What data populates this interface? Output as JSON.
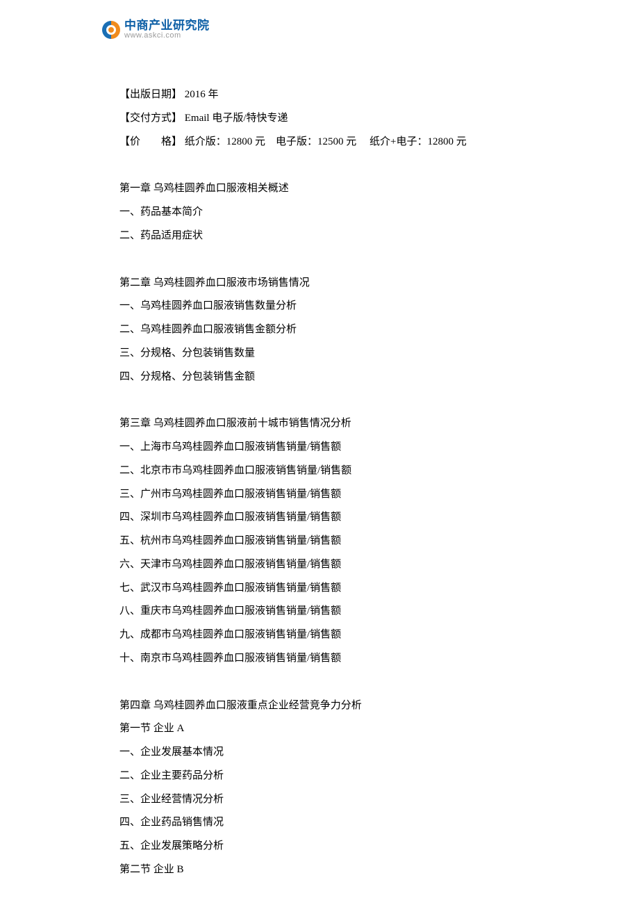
{
  "logo": {
    "name_cn": "中商产业研究院",
    "name_en": "www.askci.com"
  },
  "meta": {
    "pub_date_label": "【出版日期】",
    "pub_date_value": " 2016 年",
    "delivery_label": "【交付方式】",
    "delivery_value": " Email 电子版/特快专递",
    "price_label": "【价　　格】",
    "price_value": " 纸介版：12800 元　电子版：12500 元 　纸介+电子：12800 元"
  },
  "chapters": [
    {
      "title": "第一章 乌鸡桂圆养血口服液相关概述",
      "items": [
        "一、药品基本简介",
        "二、药品适用症状"
      ]
    },
    {
      "title": "第二章 乌鸡桂圆养血口服液市场销售情况",
      "items": [
        "一、乌鸡桂圆养血口服液销售数量分析",
        "二、乌鸡桂圆养血口服液销售金额分析",
        "三、分规格、分包装销售数量",
        "四、分规格、分包装销售金额"
      ]
    },
    {
      "title": "第三章 乌鸡桂圆养血口服液前十城市销售情况分析",
      "items": [
        "一、上海市乌鸡桂圆养血口服液销售销量/销售额",
        "二、北京市市乌鸡桂圆养血口服液销售销量/销售额",
        "三、广州市乌鸡桂圆养血口服液销售销量/销售额",
        "四、深圳市乌鸡桂圆养血口服液销售销量/销售额",
        "五、杭州市乌鸡桂圆养血口服液销售销量/销售额",
        "六、天津市乌鸡桂圆养血口服液销售销量/销售额",
        "七、武汉市乌鸡桂圆养血口服液销售销量/销售额",
        "八、重庆市乌鸡桂圆养血口服液销售销量/销售额",
        "九、成都市乌鸡桂圆养血口服液销售销量/销售额",
        "十、南京市乌鸡桂圆养血口服液销售销量/销售额"
      ]
    },
    {
      "title": "第四章 乌鸡桂圆养血口服液重点企业经营竞争力分析",
      "items": [
        "第一节 企业 A",
        "一、企业发展基本情况",
        "二、企业主要药品分析",
        "三、企业经营情况分析",
        "四、企业药品销售情况",
        "五、企业发展策略分析",
        "第二节 企业 B"
      ]
    }
  ]
}
